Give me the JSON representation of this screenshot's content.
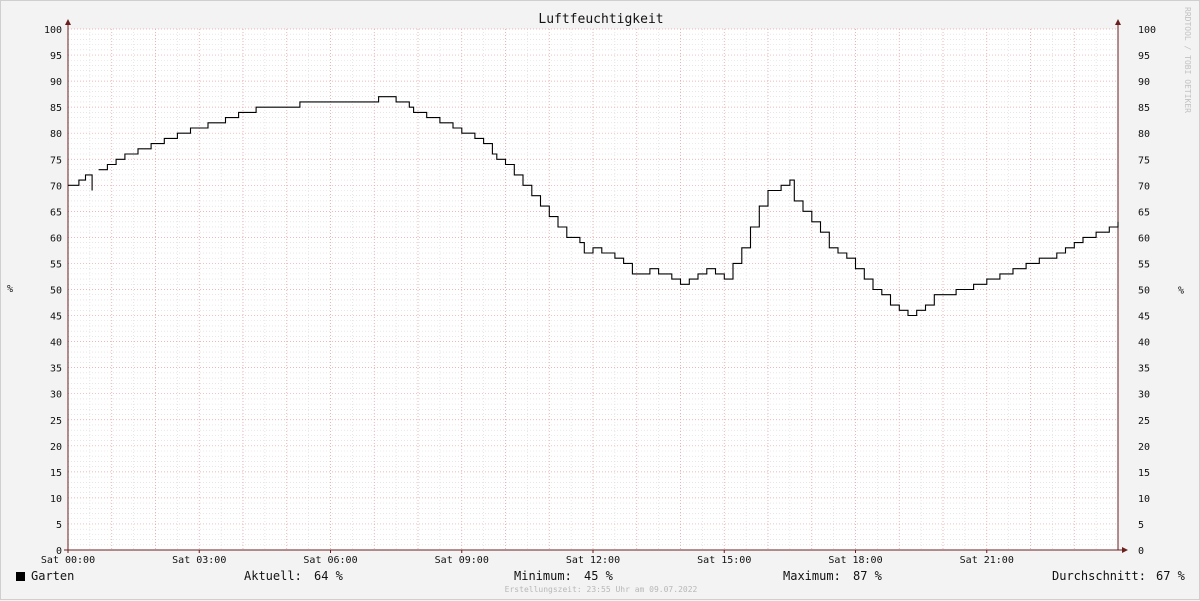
{
  "chart_data": {
    "type": "line",
    "title": "Luftfeuchtigkeit",
    "ylabel": "%",
    "ylim": [
      0,
      100
    ],
    "y_ticks": [
      "0",
      "5",
      "10",
      "15",
      "20",
      "25",
      "30",
      "35",
      "40",
      "45",
      "50",
      "55",
      "60",
      "65",
      "70",
      "75",
      "80",
      "85",
      "90",
      "95",
      "100"
    ],
    "x_ticks": [
      "Sat 00:00",
      "Sat 03:00",
      "Sat 06:00",
      "Sat 09:00",
      "Sat 12:00",
      "Sat 15:00",
      "Sat 18:00",
      "Sat 21:00"
    ],
    "x_tick_hours": [
      0,
      3,
      6,
      9,
      12,
      15,
      18,
      21
    ],
    "xlim_hours": [
      0,
      24
    ],
    "grid": true,
    "series": [
      {
        "name": "Garten",
        "color": "#000000",
        "points": [
          [
            0.0,
            70
          ],
          [
            0.25,
            71
          ],
          [
            0.4,
            72
          ],
          [
            0.55,
            69
          ],
          [
            0.6,
            null
          ],
          [
            0.7,
            73
          ],
          [
            0.9,
            74
          ],
          [
            1.1,
            75
          ],
          [
            1.3,
            76
          ],
          [
            1.6,
            77
          ],
          [
            1.9,
            78
          ],
          [
            2.2,
            79
          ],
          [
            2.5,
            80
          ],
          [
            2.8,
            81
          ],
          [
            3.2,
            82
          ],
          [
            3.6,
            83
          ],
          [
            3.9,
            84
          ],
          [
            4.3,
            85
          ],
          [
            5.3,
            86
          ],
          [
            7.1,
            87
          ],
          [
            7.5,
            86
          ],
          [
            7.8,
            85
          ],
          [
            7.9,
            84
          ],
          [
            8.2,
            83
          ],
          [
            8.5,
            82
          ],
          [
            8.8,
            81
          ],
          [
            9.0,
            80
          ],
          [
            9.3,
            79
          ],
          [
            9.5,
            78
          ],
          [
            9.7,
            76
          ],
          [
            9.8,
            75
          ],
          [
            10.0,
            74
          ],
          [
            10.2,
            72
          ],
          [
            10.4,
            70
          ],
          [
            10.6,
            68
          ],
          [
            10.8,
            66
          ],
          [
            11.0,
            64
          ],
          [
            11.2,
            62
          ],
          [
            11.4,
            60
          ],
          [
            11.7,
            59
          ],
          [
            11.8,
            57
          ],
          [
            12.0,
            58
          ],
          [
            12.2,
            57
          ],
          [
            12.5,
            56
          ],
          [
            12.7,
            55
          ],
          [
            12.9,
            53
          ],
          [
            13.3,
            54
          ],
          [
            13.5,
            53
          ],
          [
            13.8,
            52
          ],
          [
            14.0,
            51
          ],
          [
            14.2,
            52
          ],
          [
            14.4,
            53
          ],
          [
            14.6,
            54
          ],
          [
            14.8,
            53
          ],
          [
            15.0,
            52
          ],
          [
            15.2,
            55
          ],
          [
            15.4,
            58
          ],
          [
            15.6,
            62
          ],
          [
            15.8,
            66
          ],
          [
            16.0,
            69
          ],
          [
            16.3,
            70
          ],
          [
            16.5,
            71
          ],
          [
            16.6,
            67
          ],
          [
            16.8,
            65
          ],
          [
            17.0,
            63
          ],
          [
            17.2,
            61
          ],
          [
            17.4,
            58
          ],
          [
            17.6,
            57
          ],
          [
            17.8,
            56
          ],
          [
            18.0,
            54
          ],
          [
            18.2,
            52
          ],
          [
            18.4,
            50
          ],
          [
            18.6,
            49
          ],
          [
            18.8,
            47
          ],
          [
            19.0,
            46
          ],
          [
            19.2,
            45
          ],
          [
            19.4,
            46
          ],
          [
            19.6,
            47
          ],
          [
            19.8,
            49
          ],
          [
            20.3,
            50
          ],
          [
            20.7,
            51
          ],
          [
            21.0,
            52
          ],
          [
            21.3,
            53
          ],
          [
            21.6,
            54
          ],
          [
            21.9,
            55
          ],
          [
            22.2,
            56
          ],
          [
            22.6,
            57
          ],
          [
            22.8,
            58
          ],
          [
            23.0,
            59
          ],
          [
            23.2,
            60
          ],
          [
            23.5,
            61
          ],
          [
            23.8,
            62
          ],
          [
            24.0,
            63
          ]
        ]
      }
    ]
  },
  "side_label": "RRDTOOL / TOBI OETIKER",
  "legend": {
    "series_name": "Garten",
    "current_label": "Aktuell:",
    "current_value": "64 %",
    "min_label": "Minimum:",
    "min_value": "45 %",
    "max_label": "Maximum:",
    "max_value": "87 %",
    "avg_label": "Durchschnitt:",
    "avg_value": "67 %"
  },
  "footer": "Erstellungszeit: 23:55 Uhr am 09.07.2022",
  "colors": {
    "major_grid": "#e8a0a0",
    "minor_grid": "#d8d8d8",
    "axis": "#6b1f1f",
    "line": "#000000"
  }
}
